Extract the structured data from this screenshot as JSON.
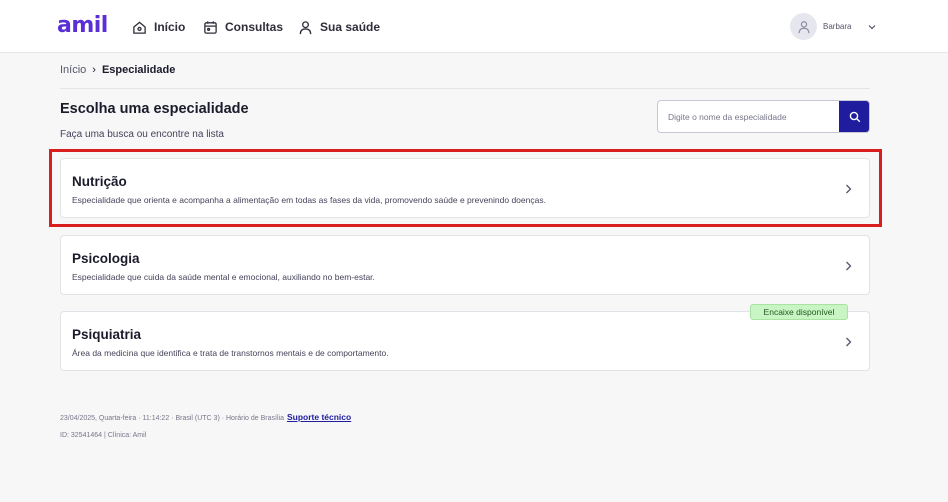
{
  "header": {
    "logo": "amil",
    "nav": [
      {
        "label": "Início",
        "icon": "home-icon"
      },
      {
        "label": "Consultas",
        "icon": "calendar-icon"
      },
      {
        "label": "Sua saúde",
        "icon": "person-icon"
      }
    ],
    "user": {
      "name": "Barbara",
      "icon": "avatar-icon"
    }
  },
  "breadcrumb": {
    "home": "Início",
    "separator": "›",
    "current": "Especialidade"
  },
  "page": {
    "title": "Escolha uma especialidade",
    "subtitle": "Faça uma busca ou encontre na lista"
  },
  "search": {
    "placeholder": "Digite o nome da especialidade",
    "value": ""
  },
  "specialties": [
    {
      "name": "Nutrição",
      "description": "Especialidade que orienta e acompanha a alimentação em todas as fases da vida, promovendo saúde e prevenindo doenças."
    },
    {
      "name": "Psicologia",
      "description": "Especialidade que cuida da saúde mental e emocional, auxiliando no bem-estar."
    },
    {
      "name": "Psiquiatria",
      "description": "Área da medicina que identifica e trata de transtornos mentais e de comportamento.",
      "badge": "Encaixe disponível"
    }
  ],
  "footer": {
    "info": "23/04/2025, Quarta-feira · 11:14:22 · Brasil (UTC 3) · Horário de Brasília",
    "support_link": "Suporte técnico",
    "ids": "ID: 32541464 | Clínica: Amil"
  },
  "colors": {
    "brand": "#5b2fd6",
    "primary_button": "#1f1c9e",
    "highlight": "#d81e1e",
    "badge_bg": "#c9f5c4"
  }
}
